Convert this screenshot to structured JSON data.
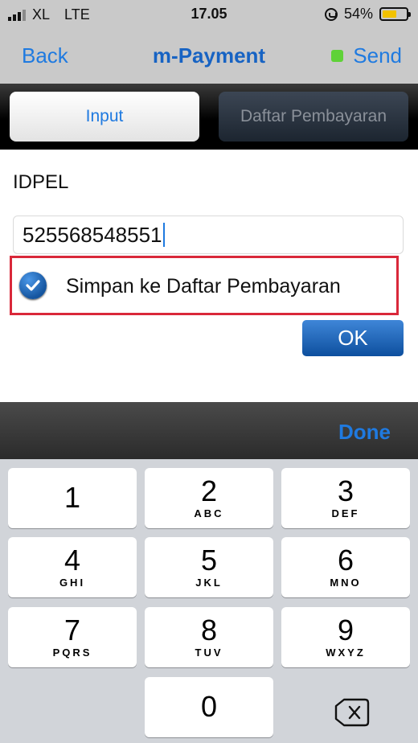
{
  "status_bar": {
    "carrier": "XL",
    "network": "LTE",
    "time": "17.05",
    "battery": "54%"
  },
  "nav": {
    "back_label": "Back",
    "title": "m-Payment",
    "send_label": "Send"
  },
  "segments": {
    "input_label": "Input",
    "daftar_label": "Daftar Pembayaran"
  },
  "form": {
    "idpel_label": "IDPEL",
    "idpel_value": "525568548551",
    "save_checkbox_label": "Simpan ke Daftar Pembayaran",
    "save_checked": true,
    "ok_label": "OK"
  },
  "keyboard": {
    "done_label": "Done",
    "keys": [
      {
        "num": "1",
        "letters": ""
      },
      {
        "num": "2",
        "letters": "ABC"
      },
      {
        "num": "3",
        "letters": "DEF"
      },
      {
        "num": "4",
        "letters": "GHI"
      },
      {
        "num": "5",
        "letters": "JKL"
      },
      {
        "num": "6",
        "letters": "MNO"
      },
      {
        "num": "7",
        "letters": "PQRS"
      },
      {
        "num": "8",
        "letters": "TUV"
      },
      {
        "num": "9",
        "letters": "WXYZ"
      },
      {
        "num": "0",
        "letters": ""
      }
    ],
    "delete_icon": "backspace-icon"
  },
  "colors": {
    "accent": "#1f7ae0",
    "highlight_border": "#d9283a",
    "send_indicator": "#5fd238"
  }
}
